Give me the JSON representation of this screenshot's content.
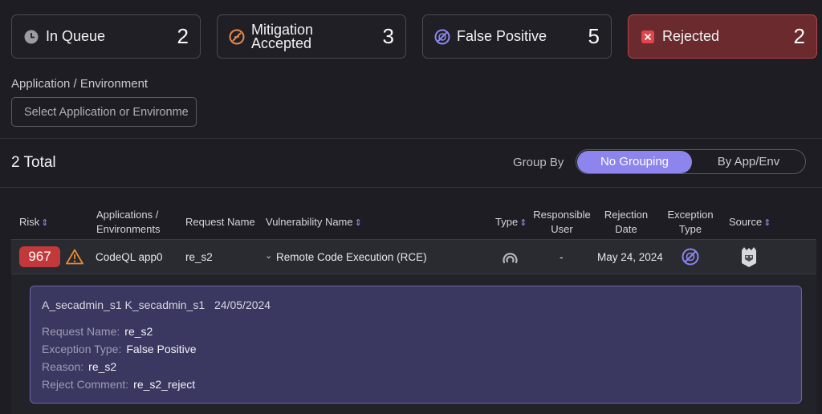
{
  "status_cards": [
    {
      "label": "In Queue",
      "count": "2",
      "icon": "clock-icon"
    },
    {
      "label_line1": "Mitigation",
      "label_line2": "Accepted",
      "count": "3",
      "icon": "mitigation-icon"
    },
    {
      "label": "False Positive",
      "count": "5",
      "icon": "false-positive-icon"
    },
    {
      "label": "Rejected",
      "count": "2",
      "icon": "close-box-icon"
    }
  ],
  "filter": {
    "label": "Application / Environment",
    "placeholder": "Select Application or Environme"
  },
  "summary": {
    "total": "2 Total"
  },
  "group_by": {
    "label": "Group By",
    "options": [
      "No Grouping",
      "By App/Env"
    ],
    "selected": "No Grouping"
  },
  "table": {
    "headers": {
      "risk": "Risk",
      "applications_line1": "Applications /",
      "applications_line2": "Environments",
      "request_name": "Request Name",
      "vulnerability_name": "Vulnerability Name",
      "type": "Type",
      "responsible_line1": "Responsible",
      "responsible_line2": "User",
      "rejection_line1": "Rejection",
      "rejection_line2": "Date",
      "exception_line1": "Exception",
      "exception_line2": "Type",
      "source": "Source"
    },
    "rows": [
      {
        "risk": "967",
        "application": "CodeQL app0",
        "request_name": "re_s2",
        "vulnerability": "Remote Code Execution (RCE)",
        "responsible_user": "-",
        "rejection_date": "May 24, 2024"
      }
    ]
  },
  "detail": {
    "header_user": "A_secadmin_s1 K_secadmin_s1",
    "header_date": "24/05/2024",
    "request_name_label": "Request Name:",
    "request_name_value": "re_s2",
    "exception_type_label": "Exception Type:",
    "exception_type_value": "False Positive",
    "reason_label": "Reason:",
    "reason_value": "re_s2",
    "reject_comment_label": "Reject Comment:",
    "reject_comment_value": "re_s2_reject"
  },
  "colors": {
    "accent": "#8e84ee",
    "rejected_bg": "#6a2a2e",
    "risk_badge": "#c2393b",
    "detail_bg": "#3a3760"
  }
}
